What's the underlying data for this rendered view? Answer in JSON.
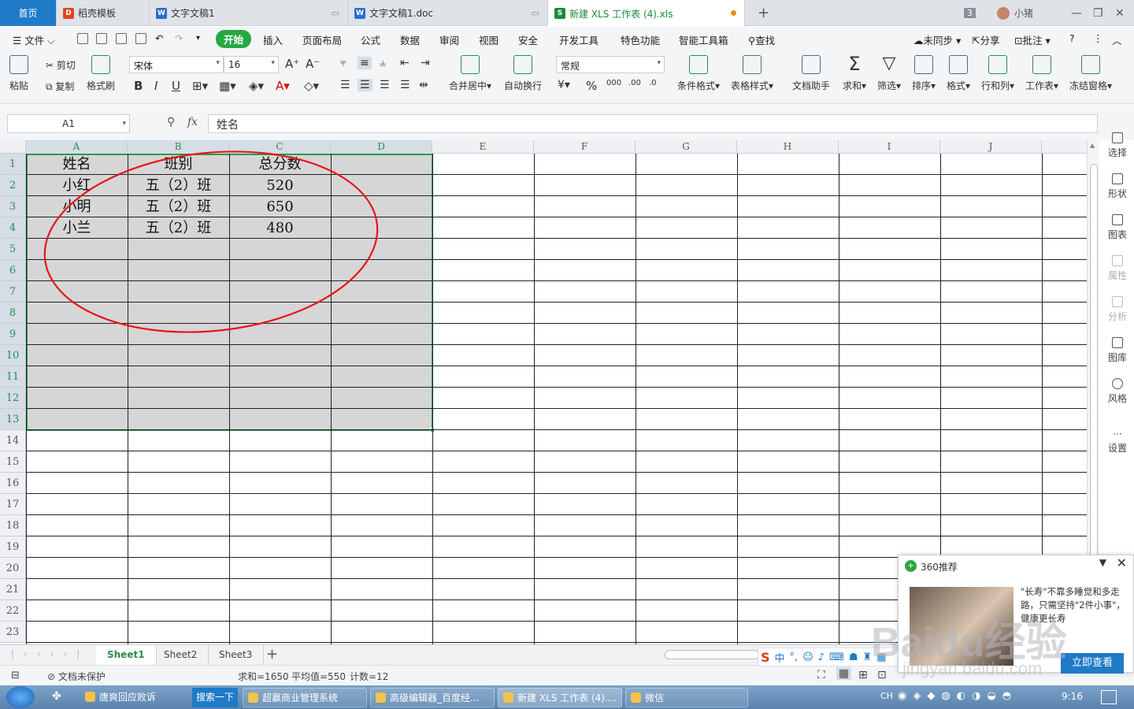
{
  "tabs": {
    "home": "首页",
    "items": [
      {
        "label": "稻壳模板",
        "icon": "daoke-icon",
        "color": "#e0461e"
      },
      {
        "label": "文字文稿1",
        "icon": "word-icon",
        "color": "#2a6fc9"
      },
      {
        "label": "文字文稿1.doc",
        "icon": "word-icon",
        "color": "#2a6fc9"
      },
      {
        "label": "新建 XLS 工作表 (4).xls",
        "icon": "sheet-icon",
        "color": "#1a8a3a"
      }
    ],
    "add": "+",
    "badge": "3",
    "user": "小猪"
  },
  "menu": {
    "file": "文件",
    "items": [
      "开始",
      "插入",
      "页面布局",
      "公式",
      "数据",
      "审阅",
      "视图",
      "安全",
      "开发工具",
      "特色功能",
      "智能工具箱",
      "查找"
    ],
    "sync": "未同步",
    "share": "分享",
    "comment": "批注"
  },
  "ribbon": {
    "paste": "粘贴",
    "cut": "剪切",
    "copy": "复制",
    "format_painter": "格式刷",
    "font_name": "宋体",
    "font_size": "16",
    "merge": "合并居中",
    "wrap": "自动换行",
    "number_format": "常规",
    "cond_format": "条件格式",
    "table_style": "表格样式",
    "doc_helper": "文档助手",
    "sum": "求和",
    "filter": "筛选",
    "sort": "排序",
    "format": "格式",
    "rowcol": "行和列",
    "worksheet": "工作表",
    "freeze": "冻结窗格"
  },
  "formula": {
    "cell_ref": "A1",
    "fx": "fx",
    "value": "姓名"
  },
  "grid": {
    "columns": [
      "A",
      "B",
      "C",
      "D",
      "E",
      "F",
      "G",
      "H",
      "I",
      "J"
    ],
    "rows": [
      "1",
      "2",
      "3",
      "4",
      "5",
      "6",
      "7",
      "8",
      "9",
      "10",
      "11",
      "12",
      "13",
      "14",
      "15",
      "16",
      "17",
      "18",
      "19",
      "20",
      "21",
      "22",
      "23"
    ],
    "data": [
      [
        "姓名",
        "班别",
        "总分数"
      ],
      [
        "小红",
        "五（2）班",
        "520"
      ],
      [
        "小明",
        "五（2）班",
        "650"
      ],
      [
        "小兰",
        "五（2）班",
        "480"
      ]
    ]
  },
  "sidebar": [
    "选择",
    "形状",
    "图表",
    "属性",
    "分析",
    "图库",
    "风格",
    "设置"
  ],
  "sheets": [
    "Sheet1",
    "Sheet2",
    "Sheet3"
  ],
  "status": {
    "protect": "文档未保护",
    "sum": "求和=1650",
    "avg": "平均值=550",
    "count": "计数=12"
  },
  "popup": {
    "title": "360推荐",
    "text": "\"长寿\"不靠多睡觉和多走路，只需坚持\"2件小事\"，健康更长寿",
    "button": "立即查看"
  },
  "taskbar": {
    "items": [
      "唐爽回应败诉",
      "搜索一下",
      "超赢商业管理系统",
      "高级编辑器_百度经...",
      "新建 XLS 工作表 (4)....",
      "微信"
    ],
    "lang": "CH",
    "time": "9:16"
  },
  "ime": "中",
  "watermark": "Baidu经验",
  "watermark_url": "jingyan.baidu.com"
}
